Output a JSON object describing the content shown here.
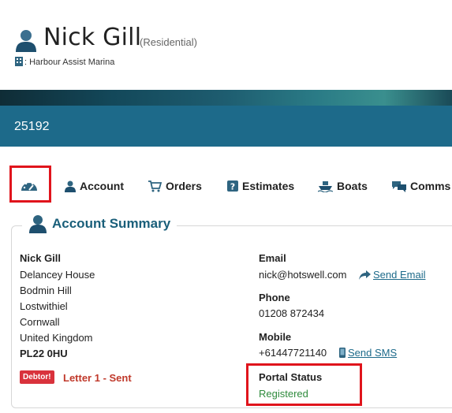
{
  "customer": {
    "name": "Nick Gill",
    "type": "(Residential)",
    "marina_line": ": Harbour Assist Marina"
  },
  "account_id": "25192",
  "tabs": [
    {
      "label": "Account",
      "icon": "person-icon"
    },
    {
      "label": "Orders",
      "icon": "cart-icon"
    },
    {
      "label": "Estimates",
      "icon": "question-icon"
    },
    {
      "label": "Boats",
      "icon": "boat-icon"
    },
    {
      "label": "Comms",
      "icon": "chat-icon"
    }
  ],
  "summary": {
    "title": "Account Summary",
    "address": [
      "Nick Gill",
      "Delancey House",
      "Bodmin Hill",
      "Lostwithiel",
      "Cornwall",
      "United Kingdom",
      "PL22 0HU"
    ],
    "debtor_badge": "Debtor!",
    "letter_status": "Letter 1 - Sent",
    "email_label": "Email",
    "email": "nick@hotswell.com",
    "send_email": "Send Email",
    "phone_label": "Phone",
    "phone": "01208 872434",
    "mobile_label": "Mobile",
    "mobile": "+61447721140",
    "send_sms": "Send SMS",
    "portal_label": "Portal Status",
    "portal_status": "Registered"
  },
  "colors": {
    "accent": "#1d6a8a",
    "highlight": "#e0141c",
    "debtor": "#d9323c",
    "portal_ok": "#2e8b3c"
  }
}
